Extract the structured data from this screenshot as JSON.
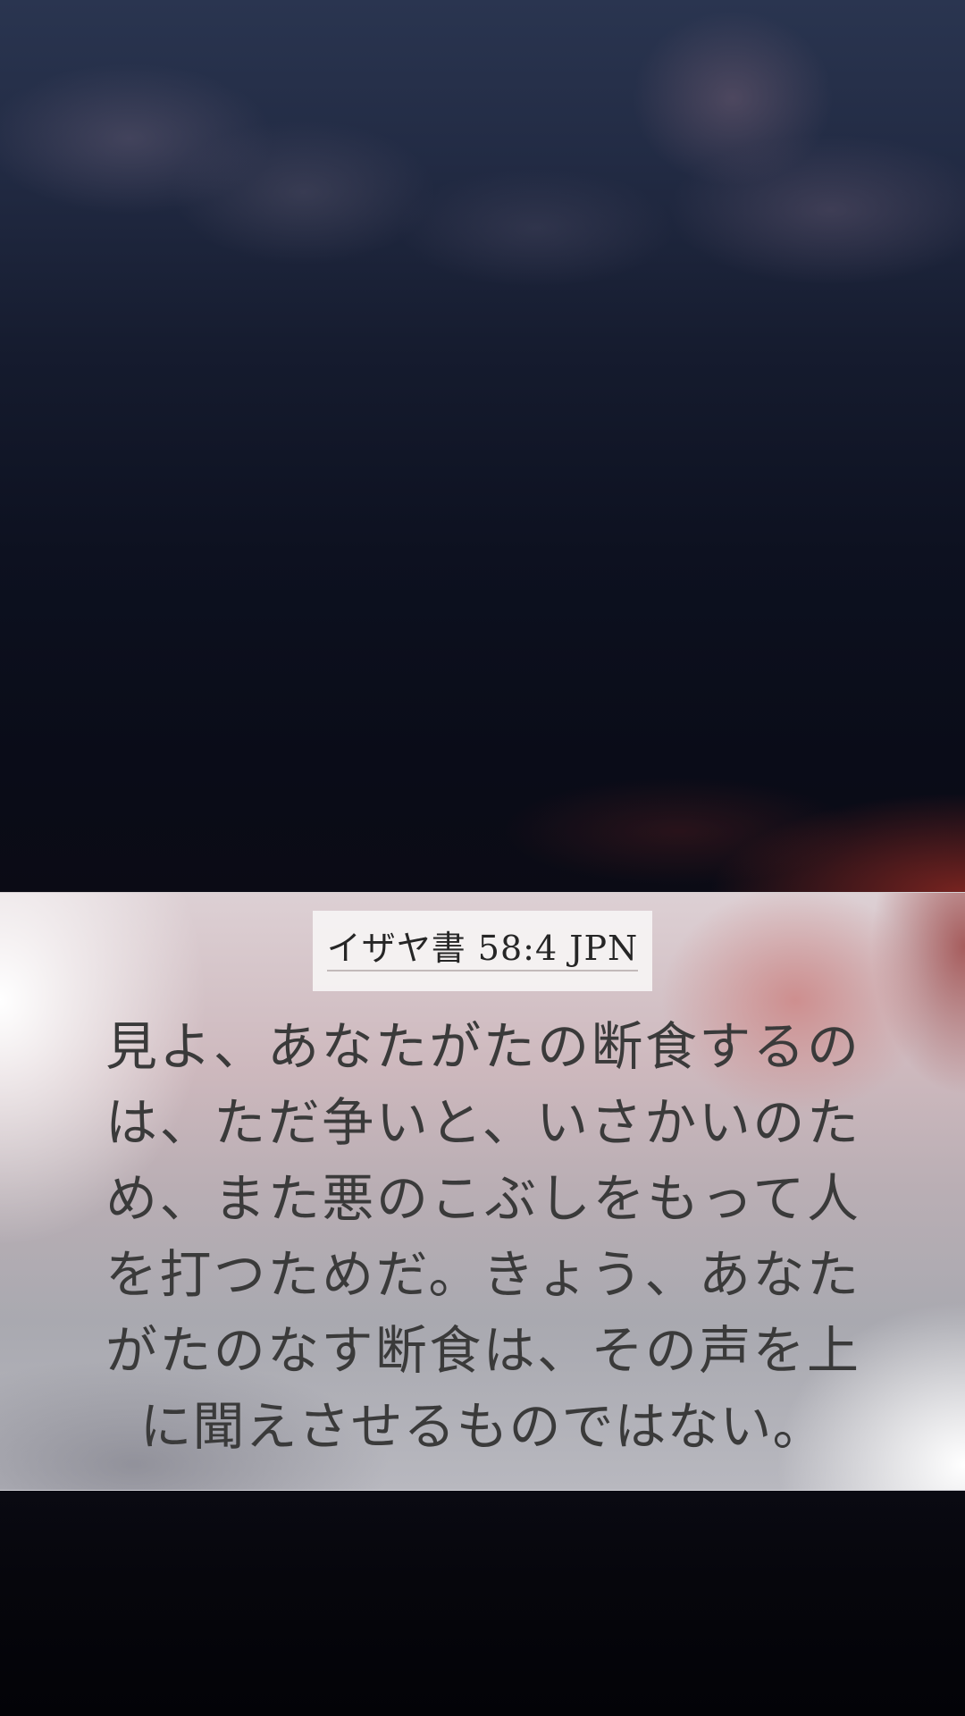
{
  "reference": "イザヤ書 58:4 JPN",
  "verse": "見よ、あなたがたの断食するのは、ただ争いと、いさかいのため、また悪のこぶしをもって人を打つためだ。きょう、あなたがたのなす断食は、その声を上に聞えさせるものではない。"
}
